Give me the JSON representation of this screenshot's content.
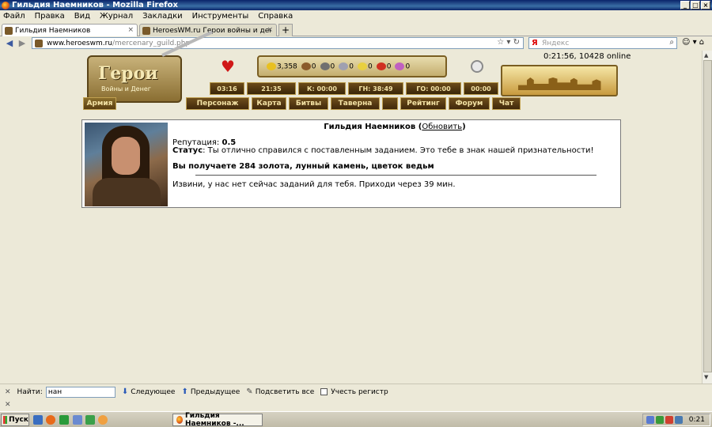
{
  "window": {
    "title": "Гильдия Наемников - Mozilla Firefox",
    "controls": [
      "_",
      "□",
      "×"
    ]
  },
  "menu": [
    "Файл",
    "Правка",
    "Вид",
    "Журнал",
    "Закладки",
    "Инструменты",
    "Справка"
  ],
  "tabs": [
    {
      "label": "Гильдия Наемников",
      "active": true
    },
    {
      "label": "HeroesWM.ru Герои войны и денег. Он...",
      "active": false
    }
  ],
  "nav": {
    "url_host": "www.heroeswm.ru",
    "url_path": "/mercenary_guild.php",
    "search_placeholder": "Яндекс",
    "search_engine_letter": "Я"
  },
  "game": {
    "online": "0:21:56, 10428 online",
    "logo_title": "Герои",
    "logo_subtitle": "Войны и Денег",
    "resources": {
      "gold": "3,358",
      "wood": "0",
      "ore": "0",
      "mercury": "0",
      "sulfur": "0",
      "crystals": "0",
      "gems": "0"
    },
    "timers": [
      "03:16",
      "21:35",
      "К: 00:00",
      "ГН: 38:49",
      "ГО: 00:00",
      "00:00"
    ],
    "nav_tabs": [
      "Армия",
      "Персонаж",
      "Карта",
      "Битвы",
      "Таверна",
      "",
      "Рейтинг",
      "Форум",
      "Чат"
    ]
  },
  "guild": {
    "title": "Гильдия Наемников",
    "refresh_link": "Обновить",
    "reputation_label": "Репутация:",
    "reputation_value": "0.5",
    "status_label": "Статус",
    "status_text": ": Ты отлично справился с поставленным заданием. Это тебе в знак нашей признательности!",
    "reward_text": "Вы получаете 284 золота, лунный камень, цветок ведьм",
    "no_jobs_text": "Извини, у нас нет сейчас заданий для тебя. Приходи через 39 мин."
  },
  "findbar": {
    "label": "Найти:",
    "value": "нан",
    "next": "Следующее",
    "prev": "Предыдущее",
    "highlight": "Подсветить все",
    "match_case": "Учесть регистр"
  },
  "taskbar": {
    "start": "Пуск",
    "task": "Гильдия Наемников -...",
    "clock": "0:21"
  },
  "colors": {
    "accent": "#0a246a",
    "gold_text": "#f3e2a5",
    "game_brown": "#40280a"
  }
}
